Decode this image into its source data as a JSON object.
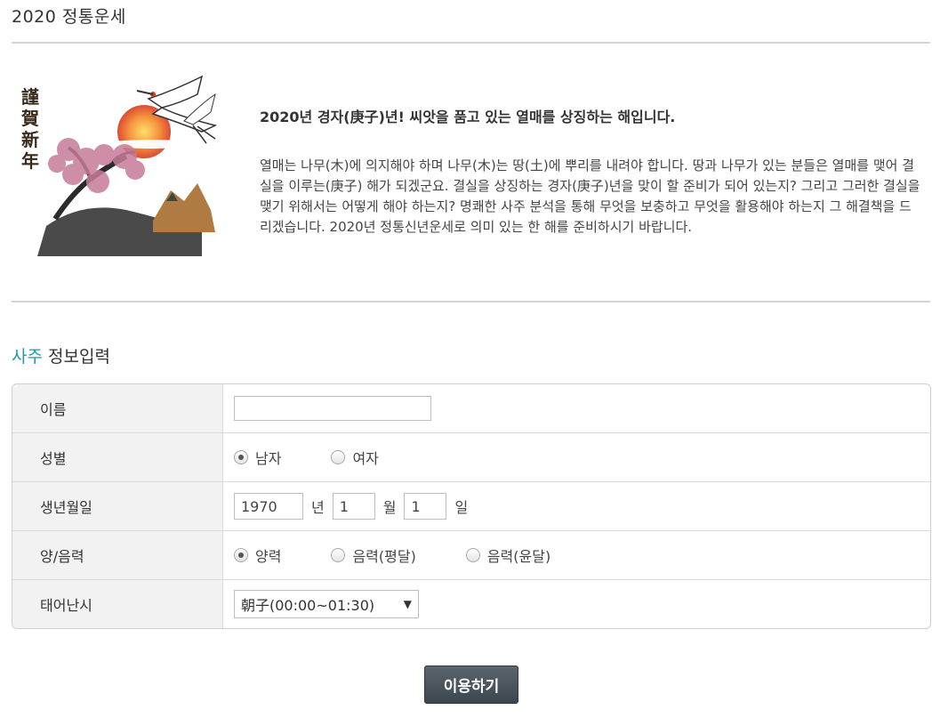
{
  "page": {
    "title": "2020 정통운세"
  },
  "intro": {
    "image_seal_text": "謹賀新年",
    "headline": "2020년 경자(庚子)년! 씨앗을 품고 있는 열매를 상징하는 해입니다.",
    "paragraph": "열매는 나무(木)에 의지해야 하며 나무(木)는 땅(土)에 뿌리를 내려야 합니다. 땅과 나무가 있는 분들은 열매를 맺어 결실을 이루는(庚子) 해가 되겠군요. 결실을 상징하는 경자(庚子)년을 맞이 할 준비가 되어 있는지? 그리고 그러한 결실을 맺기 위해서는 어떻게 해야 하는지? 명쾌한 사주 분석을 통해 무엇을 보충하고 무엇을 활용해야 하는지 그 해결책을 드리겠습니다. 2020년 정통신년운세로 의미 있는 한 해를 준비하시기 바랍니다."
  },
  "section": {
    "accent": "사주",
    "title": "정보입력"
  },
  "form": {
    "name": {
      "label": "이름",
      "value": ""
    },
    "gender": {
      "label": "성별",
      "options": [
        "남자",
        "여자"
      ],
      "selected": "남자"
    },
    "birth": {
      "label": "생년월일",
      "year": "1970",
      "year_unit": "년",
      "month": "1",
      "month_unit": "월",
      "day": "1",
      "day_unit": "일"
    },
    "calendar": {
      "label": "양/음력",
      "options": [
        "양력",
        "음력(평달)",
        "음력(윤달)"
      ],
      "selected": "양력"
    },
    "birth_time": {
      "label": "태어난시",
      "selected": "朝子(00:00~01:30)",
      "arrow": "▼"
    }
  },
  "submit": {
    "label": "이용하기"
  },
  "colors": {
    "accent": "#1f9aa9",
    "button": "#444e56"
  }
}
